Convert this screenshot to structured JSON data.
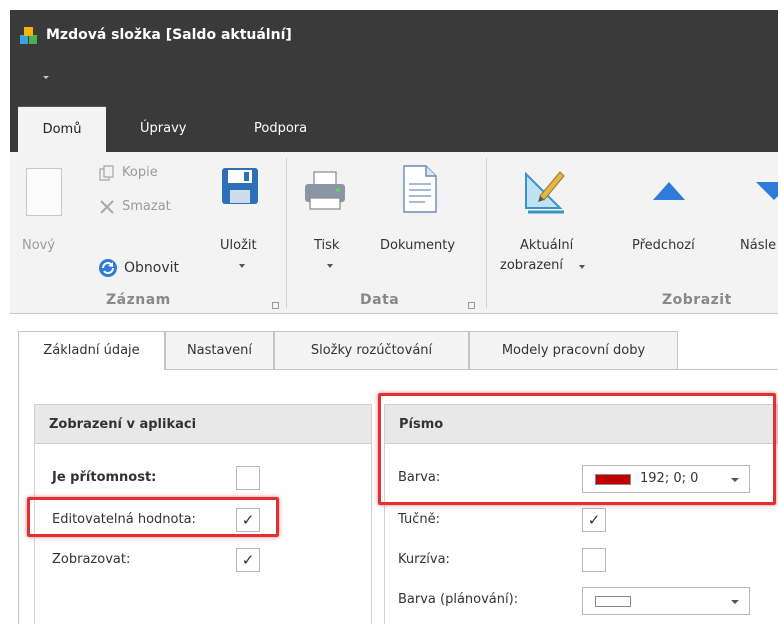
{
  "window": {
    "title": "Mzdová složka [Saldo aktuální]"
  },
  "ribbon_tabs": [
    {
      "label": "Domů",
      "active": true
    },
    {
      "label": "Úpravy",
      "active": false
    },
    {
      "label": "Podpora",
      "active": false
    }
  ],
  "ribbon": {
    "zaznam": {
      "label": "Záznam",
      "new": "Nový",
      "copy": "Kopie",
      "delete": "Smazat",
      "refresh": "Obnovit",
      "save": "Uložit"
    },
    "data": {
      "label": "Data",
      "print": "Tisk",
      "documents": "Dokumenty"
    },
    "zobrazit": {
      "label": "Zobrazit",
      "current_view_line1": "Aktuální",
      "current_view_line2": "zobrazení",
      "previous": "Předchozí",
      "next": "Násle"
    }
  },
  "content_tabs": [
    {
      "label": "Základní údaje",
      "active": true
    },
    {
      "label": "Nastavení",
      "active": false
    },
    {
      "label": "Složky rozúčtování",
      "active": false
    },
    {
      "label": "Modely pracovní doby",
      "active": false
    }
  ],
  "section_display": {
    "title": "Zobrazení v aplikaci",
    "fields": [
      {
        "label": "Je přítomnost:",
        "checked": false,
        "mark": ""
      },
      {
        "label": "Editovatelná hodnota:",
        "checked": true,
        "mark": "✓"
      },
      {
        "label": "Zobrazovat:",
        "checked": true,
        "mark": "✓"
      }
    ]
  },
  "section_font": {
    "title": "Písmo",
    "color_label": "Barva:",
    "color_value": "192; 0; 0",
    "color_swatch": "#c00000",
    "bold_label": "Tučně:",
    "bold_mark": "✓",
    "italic_label": "Kurzíva:",
    "italic_mark": "",
    "plan_color_label": "Barva (plánování):",
    "plan_color_swatch": "#ffffff"
  },
  "colors": {
    "titlebar": "#3a3a3a",
    "ribbon": "#f3f3f3",
    "highlight": "#e03030"
  }
}
